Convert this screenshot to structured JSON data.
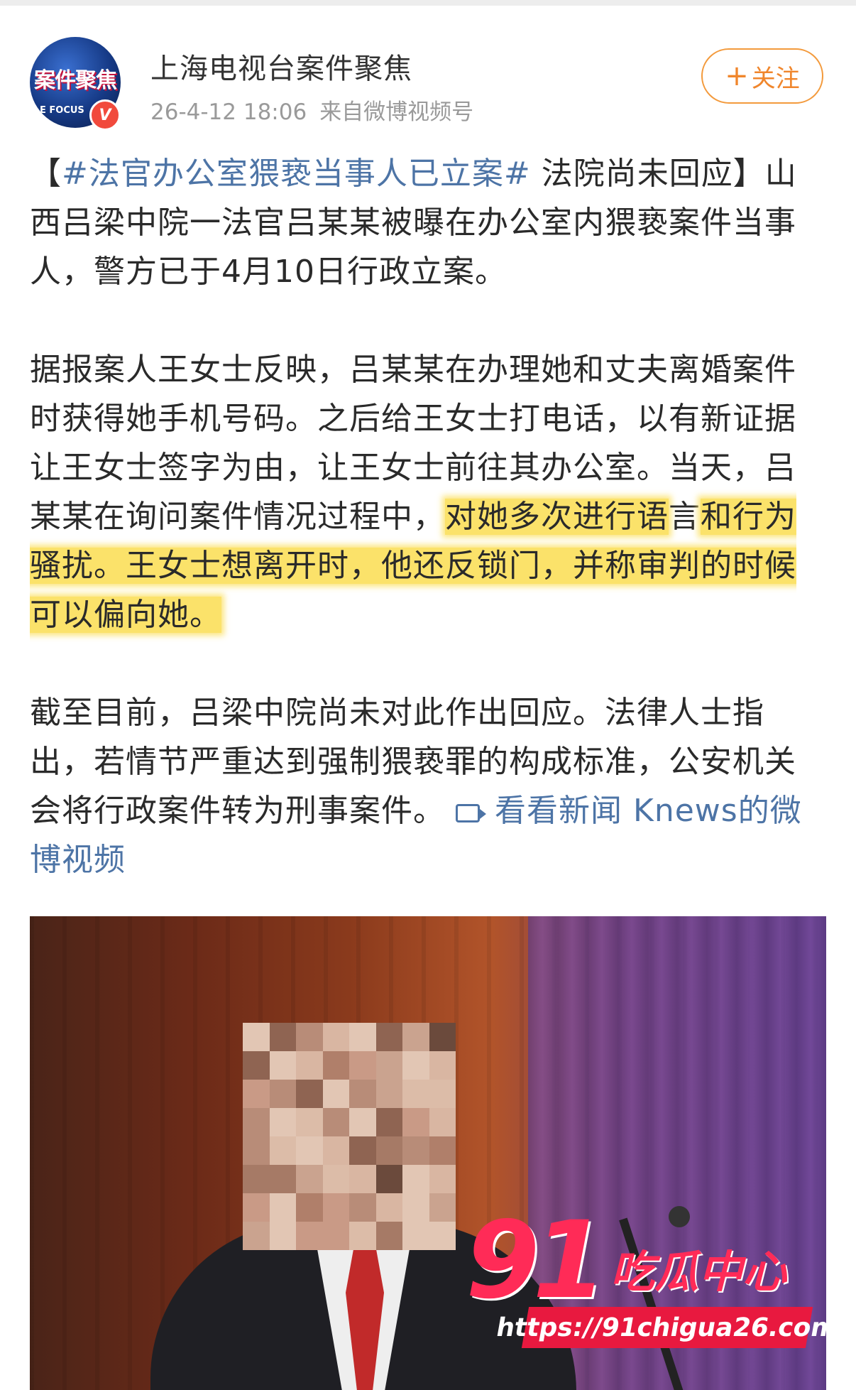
{
  "header": {
    "avatar_text": "案件聚焦",
    "avatar_subtext": "E FOCUS",
    "verified_mark": "V",
    "account_name": "上海电视台案件聚焦",
    "timestamp": "26-4-12 18:06",
    "source": "来自微博视频号",
    "follow_label": "关注"
  },
  "post": {
    "bracket_open": "【",
    "hashtag": "#法官办公室猥亵当事人已立案#",
    "p1_after_hashtag": " 法院尚未回应】山西吕梁中院一法官吕某某被曝在办公室内猥亵案件当事人，警方已于4月10日行政立案。",
    "p2_before_highlight": "据报案人王女士反映，吕某某在办理她和丈夫离婚案件时获得她手机号码。之后给王女士打电话，以有新证据让王女士签字为由，让王女士前往其办公室。当天，吕某某在询问案件情况过程中，",
    "p2_highlight_a": "对她多次进行语",
    "p2_plain_char": "言",
    "p2_highlight_b": "和行为骚扰。王女士想离开时，他还反锁门，并称审判的时候可以偏向她。",
    "p3_text": "截至目前，吕梁中院尚未对此作出回应。法律人士指出，若情节严重达到强制猥亵罪的构成标准，公安机关会将行政案件转为刑事案件。 ",
    "video_link": "看看新闻 Knews的微博视频"
  },
  "watermark": {
    "number": "91",
    "name": "吃瓜中心",
    "url": "https://91chigua26.com"
  },
  "colors": {
    "link": "#4d74a6",
    "follow": "#f0862c",
    "highlight": "#fbe26a",
    "watermark": "#ff2b57"
  },
  "icons": [
    "verified-icon",
    "plus-icon",
    "video-link-icon"
  ]
}
